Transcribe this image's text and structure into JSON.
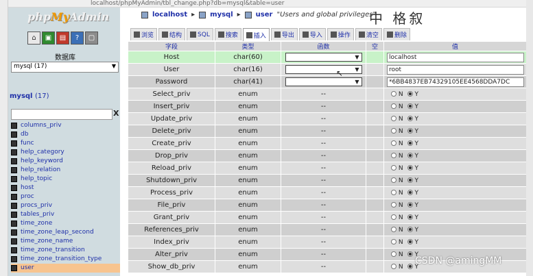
{
  "browser": {
    "url_fragment": "localhost/phpMyAdmin/tbl_change.php?db=mysql&table=user"
  },
  "nav": {
    "logo_php": "php",
    "logo_my": "My",
    "logo_admin": "Admin",
    "icons": [
      "home-icon",
      "sql-icon",
      "logout-icon",
      "docs-icon",
      "settings-icon"
    ],
    "db_label": "数据库",
    "db_select": "mysql (17)",
    "db_name": "mysql",
    "db_count": "(17)",
    "filter_clear": "X",
    "tables": [
      "columns_priv",
      "db",
      "func",
      "help_category",
      "help_keyword",
      "help_relation",
      "help_topic",
      "host",
      "proc",
      "procs_priv",
      "tables_priv",
      "time_zone",
      "time_zone_leap_second",
      "time_zone_name",
      "time_zone_transition",
      "time_zone_transition_type",
      "user"
    ],
    "active_table": "user"
  },
  "breadcrumb": {
    "server": "localhost",
    "db": "mysql",
    "table_label": "user",
    "comment": "\"Users and global privileges\"",
    "sep": "▸"
  },
  "watermark_top": "中 格叙",
  "tabs": [
    {
      "label": "浏览",
      "active": false
    },
    {
      "label": "结构",
      "active": false
    },
    {
      "label": "SQL",
      "active": false
    },
    {
      "label": "搜索",
      "active": false
    },
    {
      "label": "插入",
      "active": true
    },
    {
      "label": "导出",
      "active": false
    },
    {
      "label": "导入",
      "active": false
    },
    {
      "label": "操作",
      "active": false
    },
    {
      "label": "清空",
      "active": false
    },
    {
      "label": "删除",
      "active": false
    }
  ],
  "table_header": {
    "field": "字段",
    "type": "类型",
    "function": "函数",
    "null": "空",
    "value": "值"
  },
  "rows": [
    {
      "field": "Host",
      "type": "char(60)",
      "value": "localhost"
    },
    {
      "field": "User",
      "type": "char(16)",
      "value": "root"
    },
    {
      "field": "Password",
      "type": "char(41)",
      "value": "*6BB4837EB74329105EE4568DDA7DC"
    }
  ],
  "enum_rows": [
    {
      "field": "Select_priv",
      "type": "enum",
      "fn": "--"
    },
    {
      "field": "Insert_priv",
      "type": "enum",
      "fn": "--"
    },
    {
      "field": "Update_priv",
      "type": "enum",
      "fn": "--"
    },
    {
      "field": "Delete_priv",
      "type": "enum",
      "fn": "--"
    },
    {
      "field": "Create_priv",
      "type": "enum",
      "fn": "--"
    },
    {
      "field": "Drop_priv",
      "type": "enum",
      "fn": "--"
    },
    {
      "field": "Reload_priv",
      "type": "enum",
      "fn": "--"
    },
    {
      "field": "Shutdown_priv",
      "type": "enum",
      "fn": "--"
    },
    {
      "field": "Process_priv",
      "type": "enum",
      "fn": "--"
    },
    {
      "field": "File_priv",
      "type": "enum",
      "fn": "--"
    },
    {
      "field": "Grant_priv",
      "type": "enum",
      "fn": "--"
    },
    {
      "field": "References_priv",
      "type": "enum",
      "fn": "--"
    },
    {
      "field": "Index_priv",
      "type": "enum",
      "fn": "--"
    },
    {
      "field": "Alter_priv",
      "type": "enum",
      "fn": "--"
    },
    {
      "field": "Show_db_priv",
      "type": "enum",
      "fn": "--"
    }
  ],
  "radio_labels": {
    "n": "N",
    "y": "Y"
  },
  "watermark": "CSDN @amingMM"
}
